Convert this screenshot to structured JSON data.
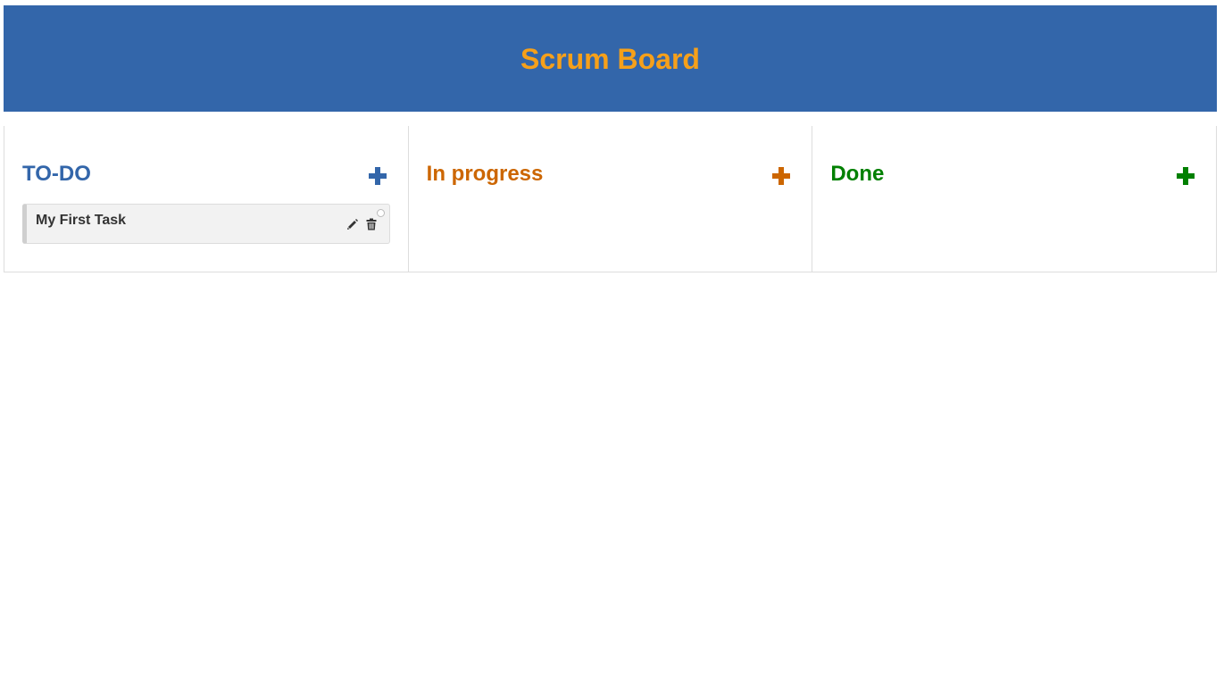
{
  "header": {
    "title": "Scrum Board"
  },
  "colors": {
    "header_bg": "#3366aa",
    "header_title": "#f6a01a",
    "todo": "#3366aa",
    "in_progress": "#cc6600",
    "done": "#008000"
  },
  "columns": [
    {
      "title": "TO-DO",
      "color": "#3366aa",
      "add_icon": "plus-icon",
      "tasks": [
        {
          "title": "My First Task",
          "edit_icon": "pencil-icon",
          "delete_icon": "trash-icon"
        }
      ]
    },
    {
      "title": "In progress",
      "color": "#cc6600",
      "add_icon": "plus-icon",
      "tasks": []
    },
    {
      "title": "Done",
      "color": "#008000",
      "add_icon": "plus-icon",
      "tasks": []
    }
  ]
}
